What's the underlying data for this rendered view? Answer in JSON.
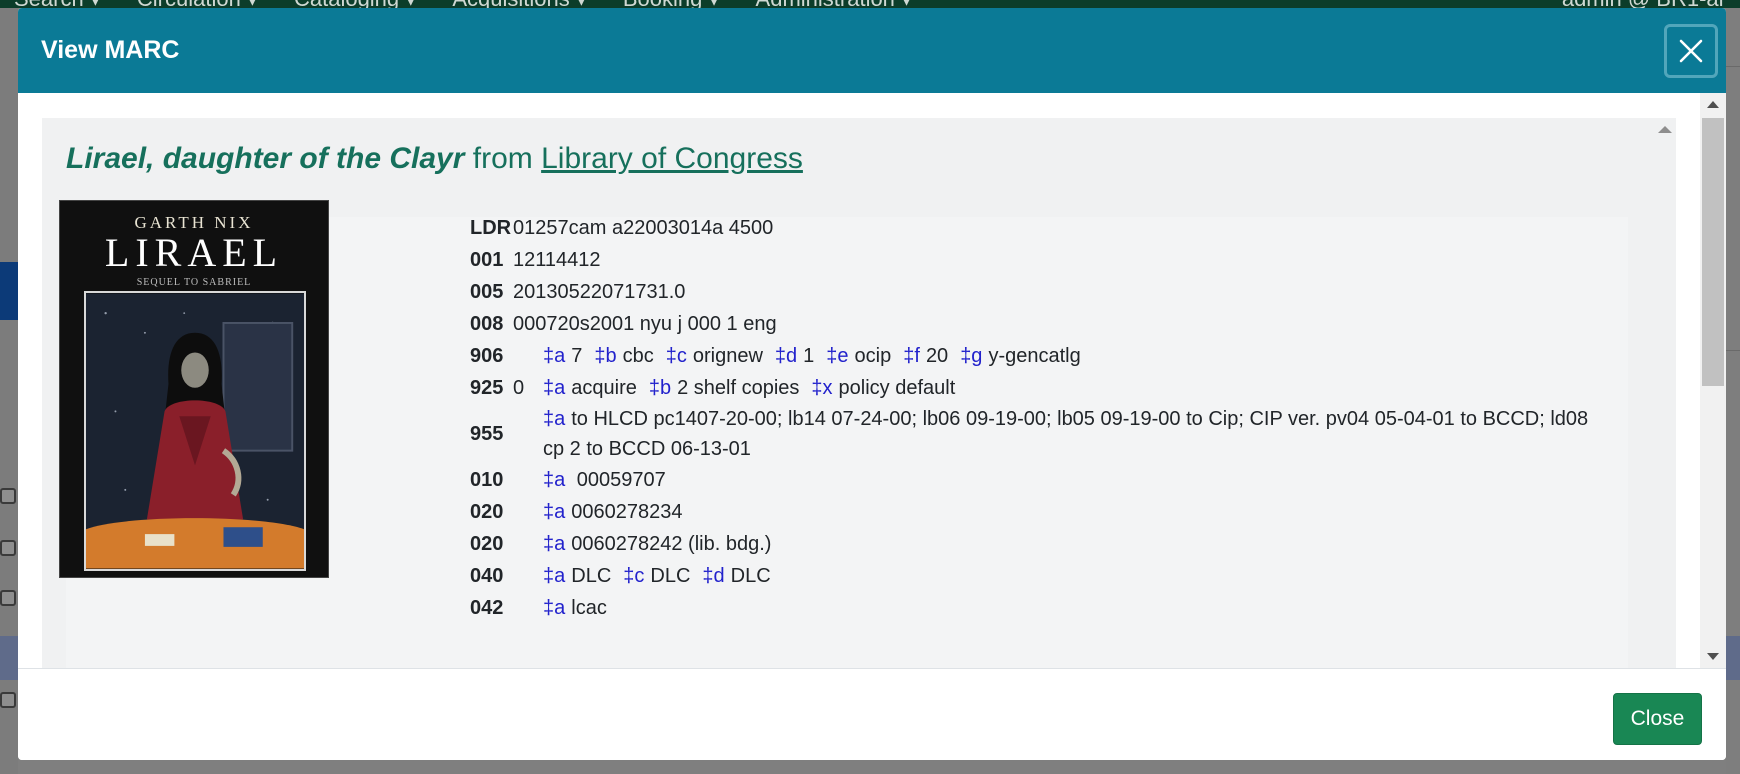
{
  "background": {
    "nav_items": [
      "Search",
      "Circulation",
      "Cataloging",
      "Acquisitions",
      "Booking",
      "Administration"
    ],
    "user": "admin @ BR1-ar"
  },
  "modal": {
    "title": "View MARC",
    "close_icon": "close-icon",
    "footer_close_label": "Close"
  },
  "record": {
    "title": "Lirael, daughter of the Clayr",
    "from_word": "from",
    "source": "Library of Congress",
    "cover": {
      "author": "GARTH NIX",
      "title": "LIRAEL",
      "subtitle": "SEQUEL TO SABRIEL"
    },
    "fields": [
      {
        "tag": "LDR",
        "ind": "",
        "value": "01257cam a22003014a 4500"
      },
      {
        "tag": "001",
        "ind": "",
        "value": "12114412"
      },
      {
        "tag": "005",
        "ind": "",
        "value": "20130522071731.0"
      },
      {
        "tag": "008",
        "ind": "",
        "value": "000720s2001 nyu j 000 1 eng"
      },
      {
        "tag": "906",
        "ind": "",
        "subfields": [
          [
            "‡a",
            "7"
          ],
          [
            "‡b",
            "cbc"
          ],
          [
            "‡c",
            "orignew"
          ],
          [
            "‡d",
            "1"
          ],
          [
            "‡e",
            "ocip"
          ],
          [
            "‡f",
            "20"
          ],
          [
            "‡g",
            "y-gencatlg"
          ]
        ]
      },
      {
        "tag": "925",
        "ind": "0",
        "subfields": [
          [
            "‡a",
            "acquire"
          ],
          [
            "‡b",
            "2 shelf copies"
          ],
          [
            "‡x",
            "policy default"
          ]
        ]
      },
      {
        "tag": "955",
        "ind": "",
        "subfields": [
          [
            "‡a",
            "to HLCD pc1407-20-00; lb14 07-24-00; lb06 09-19-00; lb05 09-19-00 to Cip; CIP ver. pv04 05-04-01 to BCCD; ld08 cp 2 to BCCD 06-13-01"
          ]
        ]
      },
      {
        "tag": "010",
        "ind": "",
        "subfields": [
          [
            "‡a",
            " 00059707"
          ]
        ]
      },
      {
        "tag": "020",
        "ind": "",
        "subfields": [
          [
            "‡a",
            "0060278234"
          ]
        ]
      },
      {
        "tag": "020",
        "ind": "",
        "subfields": [
          [
            "‡a",
            "0060278242 (lib. bdg.)"
          ]
        ]
      },
      {
        "tag": "040",
        "ind": "",
        "subfields": [
          [
            "‡a",
            "DLC"
          ],
          [
            "‡c",
            "DLC"
          ],
          [
            "‡d",
            "DLC"
          ]
        ]
      },
      {
        "tag": "042",
        "ind": "",
        "subfields": [
          [
            "‡a",
            "lcac"
          ]
        ]
      }
    ]
  },
  "colors": {
    "header": "#0b7a96",
    "title_green": "#16705c",
    "subfield_blue": "#2222cc",
    "button_green": "#198754"
  }
}
